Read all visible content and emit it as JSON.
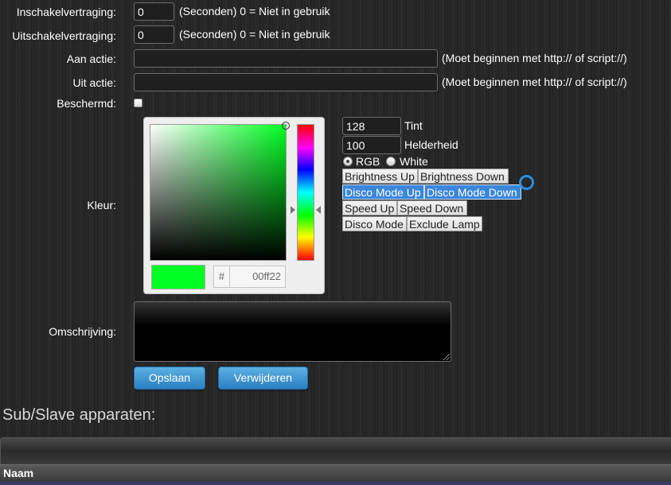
{
  "form": {
    "on_delay": {
      "label": "Inschakelvertraging:",
      "value": "0",
      "hint": "(Seconden) 0 = Niet in gebruik"
    },
    "off_delay": {
      "label": "Uitschakelvertraging:",
      "value": "0",
      "hint": "(Seconden) 0 = Niet in gebruik"
    },
    "on_action": {
      "label": "Aan actie:",
      "value": "",
      "hint": "(Moet beginnen met http:// of script://)"
    },
    "off_action": {
      "label": "Uit actie:",
      "value": "",
      "hint": "(Moet beginnen met http:// of script://)"
    },
    "protected": {
      "label": "Beschermd:",
      "checked": false
    },
    "color": {
      "label": "Kleur:",
      "hex_prefix": "#",
      "hex_value": "00ff22",
      "swatch_color": "#00ff22",
      "tint": {
        "value": "128",
        "label": "Tint"
      },
      "brightness": {
        "value": "100",
        "label": "Helderheid"
      },
      "mode_rgb": "RGB",
      "mode_white": "White",
      "selected_mode": "RGB"
    },
    "description": {
      "label": "Omschrijving:",
      "value": ""
    }
  },
  "mode_buttons": {
    "brightness_up": "Brightness Up",
    "brightness_down": "Brightness Down",
    "disco_mode_up": "Disco Mode Up",
    "disco_mode_down": "Disco Mode Down",
    "speed_up": "Speed Up",
    "speed_down": "Speed Down",
    "disco_mode": "Disco Mode",
    "exclude_lamp": "Exclude Lamp"
  },
  "actions": {
    "save": "Opslaan",
    "delete": "Verwijderen"
  },
  "sub_devices": {
    "title": "Sub/Slave apparaten:",
    "columns": [
      "Naam"
    ]
  },
  "colors": {
    "accent_blue": "#3a86dc",
    "button_blue": "#2b7fc2",
    "selected_color": "#00ff22"
  }
}
